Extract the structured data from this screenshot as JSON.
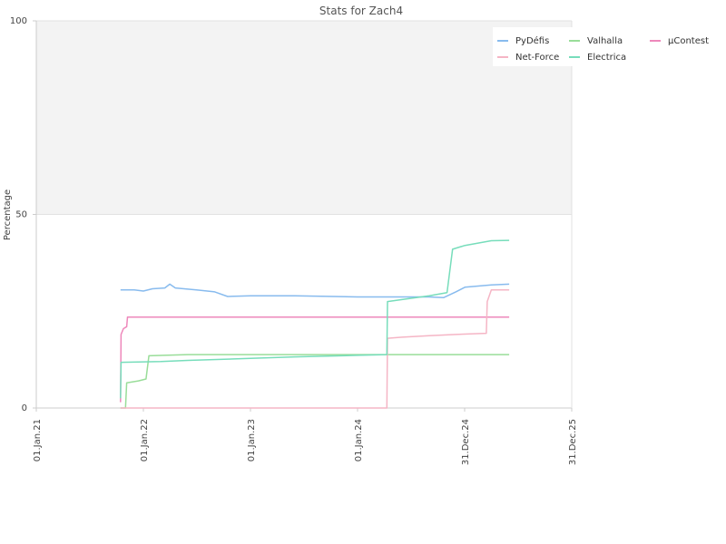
{
  "chart_data": {
    "type": "line",
    "title": "Stats for Zach4",
    "ylabel": "Percentage",
    "xlabel": "",
    "ylim": [
      0,
      100
    ],
    "yticks": [
      0,
      50,
      100
    ],
    "xlim": [
      "2021-01-01",
      "2025-12-31"
    ],
    "xticks": [
      {
        "date": "2021-01-01",
        "label": "01.Jan.21"
      },
      {
        "date": "2022-01-01",
        "label": "01.Jan.22"
      },
      {
        "date": "2023-01-01",
        "label": "01.Jan.23"
      },
      {
        "date": "2024-01-01",
        "label": "01.Jan.24"
      },
      {
        "date": "2024-12-31",
        "label": "31.Dec.24"
      },
      {
        "date": "2025-12-31",
        "label": "31.Dec.25"
      }
    ],
    "upper_band_color": "#f3f3f3",
    "legend_position": "top-right",
    "series": [
      {
        "name": "PyDéfis",
        "color": "#88bbee",
        "points": [
          [
            "2021-10-15",
            30.5
          ],
          [
            "2021-12-01",
            30.5
          ],
          [
            "2022-01-01",
            30.2
          ],
          [
            "2022-02-01",
            30.8
          ],
          [
            "2022-03-15",
            31.0
          ],
          [
            "2022-04-01",
            32.0
          ],
          [
            "2022-04-20",
            31.0
          ],
          [
            "2022-07-01",
            30.5
          ],
          [
            "2022-09-01",
            30.0
          ],
          [
            "2022-10-15",
            28.8
          ],
          [
            "2023-01-01",
            29.0
          ],
          [
            "2023-06-01",
            29.0
          ],
          [
            "2024-01-01",
            28.7
          ],
          [
            "2024-06-01",
            28.7
          ],
          [
            "2024-09-01",
            28.7
          ],
          [
            "2024-10-20",
            28.5
          ],
          [
            "2024-12-01",
            30.0
          ],
          [
            "2025-01-01",
            31.2
          ],
          [
            "2025-04-01",
            31.8
          ],
          [
            "2025-06-01",
            32.0
          ]
        ]
      },
      {
        "name": "Valhalla",
        "color": "#99dd99",
        "points": [
          [
            "2021-10-15",
            0
          ],
          [
            "2021-11-01",
            0
          ],
          [
            "2021-11-05",
            6.5
          ],
          [
            "2021-12-15",
            7.0
          ],
          [
            "2022-01-10",
            7.5
          ],
          [
            "2022-01-20",
            13.5
          ],
          [
            "2022-06-01",
            13.8
          ],
          [
            "2023-06-01",
            13.8
          ],
          [
            "2024-06-01",
            13.8
          ],
          [
            "2025-06-01",
            13.8
          ]
        ]
      },
      {
        "name": "µContest",
        "color": "#ee88bb",
        "points": [
          [
            "2021-10-15",
            1.5
          ],
          [
            "2021-10-17",
            19.0
          ],
          [
            "2021-10-25",
            20.5
          ],
          [
            "2021-11-05",
            21.0
          ],
          [
            "2021-11-08",
            23.5
          ],
          [
            "2022-06-01",
            23.5
          ],
          [
            "2023-06-01",
            23.5
          ],
          [
            "2024-06-01",
            23.5
          ],
          [
            "2025-06-01",
            23.5
          ]
        ]
      },
      {
        "name": "Net-Force",
        "color": "#f5b5c5",
        "points": [
          [
            "2021-10-15",
            0
          ],
          [
            "2022-06-01",
            0
          ],
          [
            "2023-06-01",
            0
          ],
          [
            "2024-04-10",
            0
          ],
          [
            "2024-04-12",
            18.0
          ],
          [
            "2024-06-01",
            18.3
          ],
          [
            "2024-09-01",
            18.7
          ],
          [
            "2024-12-01",
            19.0
          ],
          [
            "2025-03-15",
            19.3
          ],
          [
            "2025-03-18",
            27.5
          ],
          [
            "2025-04-01",
            30.5
          ],
          [
            "2025-06-01",
            30.5
          ]
        ]
      },
      {
        "name": "Electrica",
        "color": "#77ddbb",
        "points": [
          [
            "2021-10-15",
            2.5
          ],
          [
            "2021-10-17",
            11.8
          ],
          [
            "2022-03-01",
            12.0
          ],
          [
            "2022-06-01",
            12.3
          ],
          [
            "2023-01-01",
            12.8
          ],
          [
            "2023-06-01",
            13.2
          ],
          [
            "2024-01-01",
            13.6
          ],
          [
            "2024-04-10",
            13.8
          ],
          [
            "2024-04-12",
            27.5
          ],
          [
            "2024-06-01",
            28.0
          ],
          [
            "2024-09-01",
            29.0
          ],
          [
            "2024-11-01",
            29.8
          ],
          [
            "2024-11-20",
            41.0
          ],
          [
            "2025-01-01",
            42.0
          ],
          [
            "2025-04-01",
            43.2
          ],
          [
            "2025-06-01",
            43.3
          ]
        ]
      }
    ]
  }
}
